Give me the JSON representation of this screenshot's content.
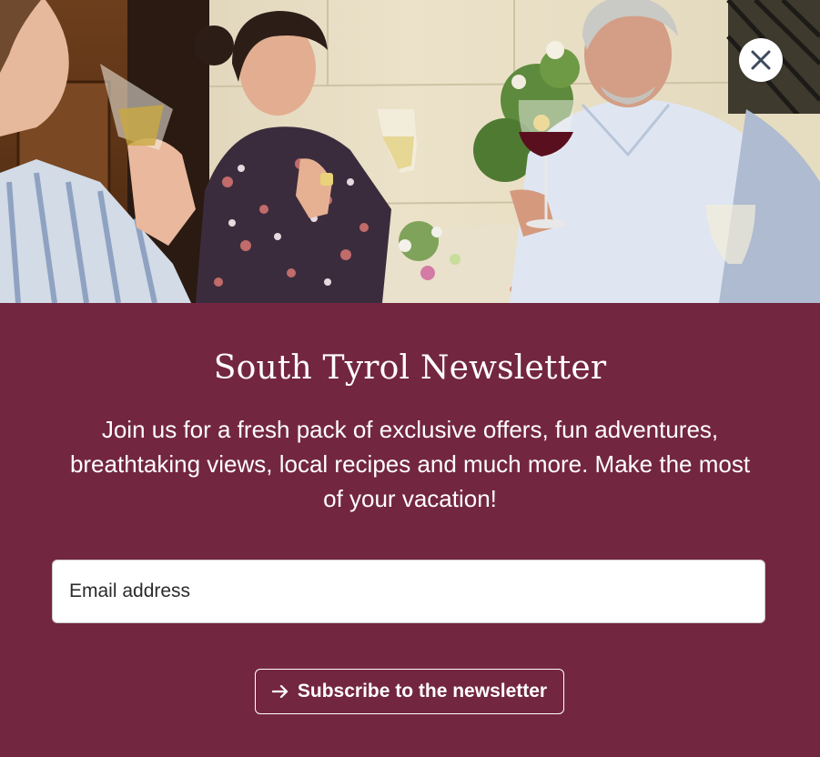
{
  "dialog": {
    "close_icon": "close-icon",
    "title": "South Tyrol Newsletter",
    "description": "Join us for a fresh pack of exclusive offers, fun adventures, breathtaking views, local recipes and much more. Make the most of your vacation!",
    "email_placeholder": "Email address",
    "email_value": "",
    "subscribe_label": "Subscribe to the newsletter",
    "subscribe_icon": "arrow-right-icon"
  },
  "colors": {
    "panel_background": "#732640",
    "text": "#ffffff",
    "close_button_bg": "#ffffff",
    "close_icon_color": "#3d4a5c"
  }
}
